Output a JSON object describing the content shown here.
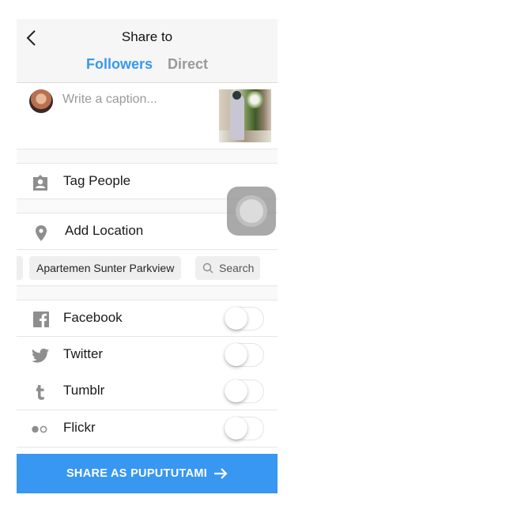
{
  "header": {
    "title": "Share to",
    "back_icon": "chevron-left-icon",
    "tabs": [
      {
        "label": "Followers",
        "active": true
      },
      {
        "label": "Direct",
        "active": false
      }
    ]
  },
  "caption": {
    "placeholder": "Write a caption...",
    "value": "",
    "avatar": "user-avatar",
    "thumbnail": "photo-thumbnail"
  },
  "options": {
    "tag_people": {
      "label": "Tag People",
      "icon": "tag-person-icon"
    },
    "add_location": {
      "label": "Add Location",
      "icon": "location-pin-icon"
    }
  },
  "location_suggestions": {
    "chips": [
      "Apartemen Sunter Parkview"
    ],
    "search_label": "Search"
  },
  "social": [
    {
      "label": "Facebook",
      "icon": "facebook-icon",
      "enabled": false
    },
    {
      "label": "Twitter",
      "icon": "twitter-icon",
      "enabled": false
    },
    {
      "label": "Tumblr",
      "icon": "tumblr-icon",
      "enabled": false
    },
    {
      "label": "Flickr",
      "icon": "flickr-icon",
      "enabled": false
    }
  ],
  "share_button": {
    "label": "SHARE AS PUPUTUTAMI",
    "icon": "arrow-right-icon"
  },
  "colors": {
    "accent": "#3897f0",
    "inactive_tab": "#999999",
    "icon_gray": "#8e8e8e"
  }
}
